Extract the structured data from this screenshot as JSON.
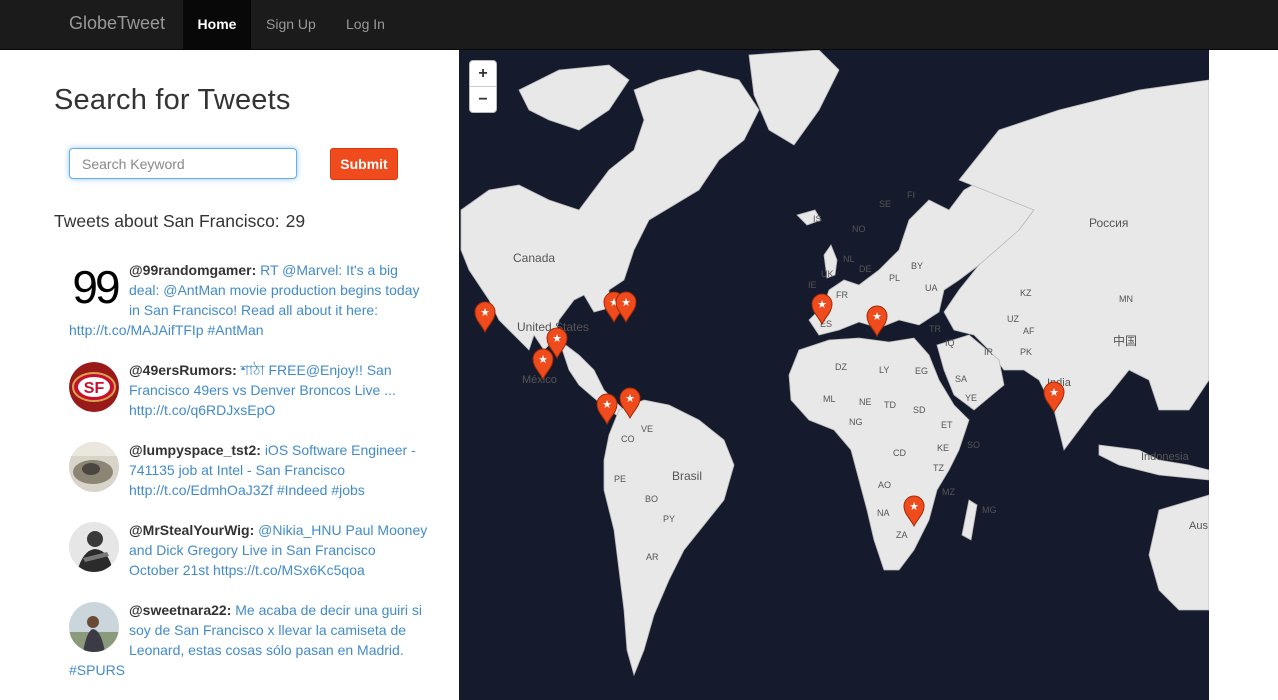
{
  "nav": {
    "brand": "GlobeTweet",
    "items": [
      {
        "label": "Home",
        "active": true
      },
      {
        "label": "Sign Up",
        "active": false
      },
      {
        "label": "Log In",
        "active": false
      }
    ]
  },
  "search": {
    "title": "Search for Tweets",
    "placeholder": "Search Keyword",
    "submit_label": "Submit"
  },
  "results": {
    "heading": "Tweets about San Francisco:",
    "count": "29"
  },
  "tweets": [
    {
      "user": "@99randomgamer:",
      "text": "RT @Marvel: It's a big deal: @AntMan movie production begins today in San Francisco! Read all about it here:",
      "cont": "http://t.co/MAJAifTFIp #AntMan",
      "avatar": "99"
    },
    {
      "user": "@49ersRumors:",
      "text": "শাঠা FREE@Enjoy!! San Francisco 49ers vs Denver Broncos Live ... http://t.co/q6RDJxsEpO",
      "avatar": "SF"
    },
    {
      "user": "@lumpyspace_tst2:",
      "text": "iOS Software Engineer - 741135 job at Intel - San Francisco http://t.co/EdmhOaJ3Zf #Indeed #jobs",
      "avatar": ""
    },
    {
      "user": "@MrStealYourWig:",
      "text": "@Nikia_HNU Paul Mooney and Dick Gregory Live in San Francisco October 21st https://t.co/MSx6Kc5qoa",
      "avatar": ""
    },
    {
      "user": "@sweetnara22:",
      "text": "Me acaba de decir una guiri si soy de San Francisco x llevar la camiseta de Leonard, estas cosas sólo pasan en Madrid.",
      "cont": "#SPURS",
      "avatar": ""
    }
  ],
  "map": {
    "zoom_in": "+",
    "zoom_out": "−",
    "labels": [
      "Canada",
      "United States",
      "México",
      "Brasil",
      "Россия",
      "中国",
      "India",
      "Indonesia",
      "Aus",
      "CO",
      "VE",
      "PE",
      "BO",
      "PY",
      "AR",
      "IS",
      "NO",
      "SE",
      "FI",
      "UK",
      "IE",
      "FR",
      "ES",
      "IT",
      "PL",
      "UA",
      "TR",
      "IR",
      "SA",
      "EG",
      "LY",
      "DZ",
      "ML",
      "NE",
      "NG",
      "TD",
      "SD",
      "ET",
      "KE",
      "CD",
      "TZ",
      "AO",
      "NA",
      "ZA",
      "MZ",
      "MG",
      "SO",
      "KZ",
      "UZ",
      "MN",
      "PK",
      "AF",
      "IQ",
      "YE",
      "NL",
      "DE",
      "BY"
    ],
    "colors": {
      "ocean": "#151a2c",
      "land": "#e8e8e8",
      "border": "#b9b9b9",
      "marker": "#f04b1d"
    },
    "marker_count": 12
  }
}
